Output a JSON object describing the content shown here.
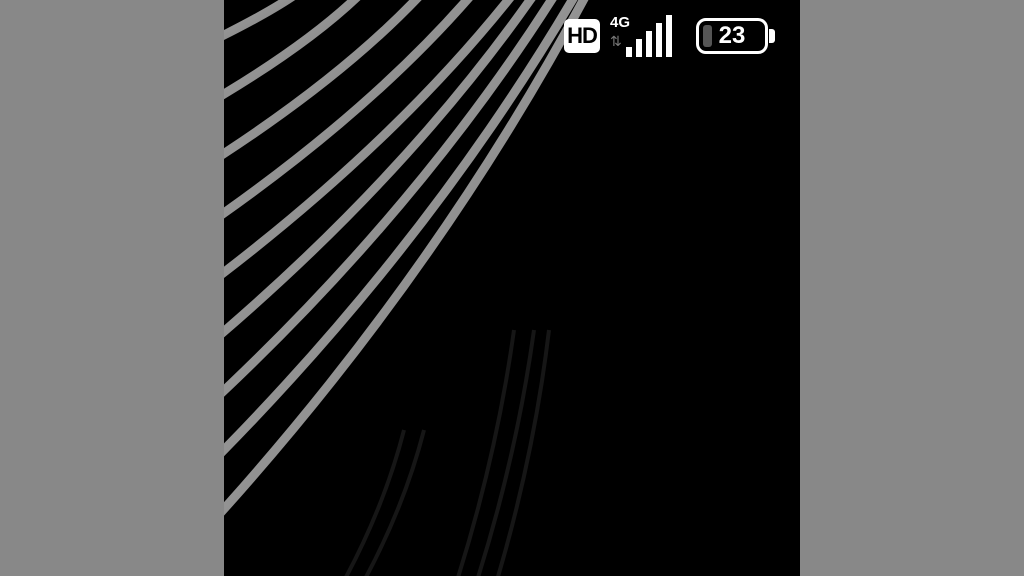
{
  "status_bar": {
    "hd_label": "HD",
    "network_type": "4G",
    "data_activity_icon": "data-arrows-icon",
    "signal_icon": "signal-bars-icon",
    "signal_level": 1.0,
    "battery_percent": "23",
    "battery_level": 0.23
  },
  "wallpaper": {
    "style": "diagonal-light-streaks",
    "background_color": "#000000",
    "streak_color": "#bdbdbd"
  },
  "frame": {
    "letterbox_color": "#888888"
  }
}
